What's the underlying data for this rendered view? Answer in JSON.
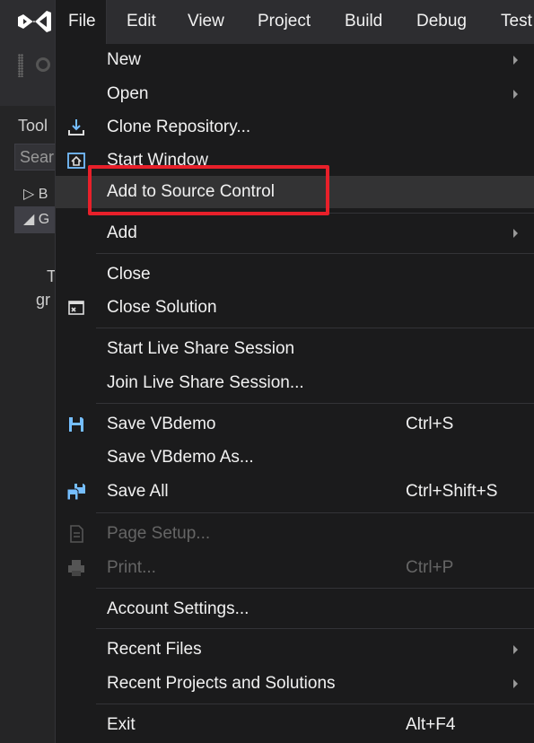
{
  "menubar": {
    "logo_icon": "visual-studio-logo-icon",
    "items": [
      "File",
      "Edit",
      "View",
      "Project",
      "Build",
      "Debug",
      "Test"
    ]
  },
  "background_panel": {
    "title": "Tool",
    "search_placeholder": "Sear",
    "tree_items": [
      "▷ B",
      "◢ G"
    ],
    "body_lines": [
      "T",
      "gr"
    ]
  },
  "file_menu": {
    "items": [
      {
        "label": "New",
        "submenu": true
      },
      {
        "label": "Open",
        "submenu": true
      },
      {
        "label": "Clone Repository...",
        "icon": "clone-repository-icon"
      },
      {
        "label": "Start Window",
        "icon": "start-window-icon"
      },
      {
        "label": "Add to Source Control",
        "hovered": true
      },
      {
        "label": "Add",
        "submenu": true
      },
      {
        "label": "Close"
      },
      {
        "label": "Close Solution",
        "icon": "close-solution-icon"
      },
      {
        "label": "Start Live Share Session"
      },
      {
        "label": "Join Live Share Session..."
      },
      {
        "label": "Save VBdemo",
        "shortcut": "Ctrl+S",
        "icon": "save-icon"
      },
      {
        "label": "Save VBdemo As..."
      },
      {
        "label": "Save All",
        "shortcut": "Ctrl+Shift+S",
        "icon": "save-all-icon"
      },
      {
        "label": "Page Setup...",
        "disabled": true,
        "icon": "page-setup-icon"
      },
      {
        "label": "Print...",
        "shortcut": "Ctrl+P",
        "disabled": true,
        "icon": "print-icon"
      },
      {
        "label": "Account Settings..."
      },
      {
        "label": "Recent Files",
        "submenu": true
      },
      {
        "label": "Recent Projects and Solutions",
        "submenu": true
      },
      {
        "label": "Exit",
        "shortcut": "Alt+F4"
      }
    ]
  },
  "colors": {
    "menu_background": "#1b1b1c",
    "menubar_background": "#2d2d30",
    "highlight": "#333334",
    "annotation_red": "#e8202a",
    "icon_blue": "#75beff",
    "disabled_text": "#656565"
  }
}
